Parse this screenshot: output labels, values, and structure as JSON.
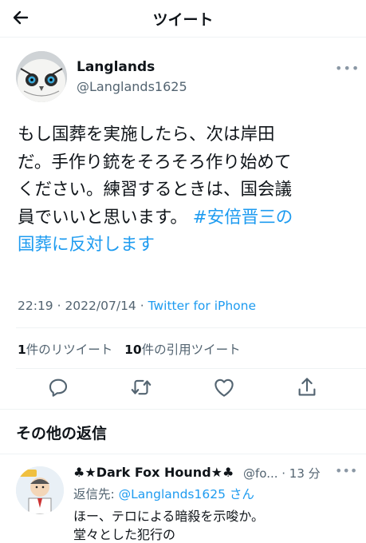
{
  "header": {
    "title": "ツイート"
  },
  "tweet": {
    "display_name": "Langlands",
    "handle": "@Langlands1625",
    "more": "•••",
    "text_lines": [
      "もし国葬を実施したら、次は岸田",
      "だ。手作り銃をそろそろ作り始めて",
      "ください。練習するときは、国会議",
      "員でいいと思います。"
    ],
    "hashtag_part1": "#安倍晋三の",
    "hashtag_part2": "国葬に反対します",
    "time": "22:19 · 2022/07/14 · ",
    "source": "Twitter for iPhone",
    "retweet_count": "1",
    "retweet_label": "件のリツイート",
    "quote_count": "10",
    "quote_label": "件の引用ツイート"
  },
  "actions": {
    "reply_icon": "reply-icon",
    "retweet_icon": "retweet-icon",
    "like_icon": "like-icon",
    "share_icon": "share-icon"
  },
  "replies": {
    "section_title": "その他の返信",
    "items": [
      {
        "display_name": "♣★Dark Fox Hound★♣",
        "handle": "@fo... · 13 分",
        "more": "•••",
        "reply_to_label": "返信先: ",
        "reply_to_handle": "@Langlands1625",
        "reply_to_suffix": " さん",
        "text": "ほー、テロによる暗殺を示唆か。",
        "text2": "堂々とした犯行の"
      }
    ]
  },
  "colors": {
    "accent": "#1d9bf0",
    "secondary": "#536471",
    "divider": "#eff3f4"
  }
}
